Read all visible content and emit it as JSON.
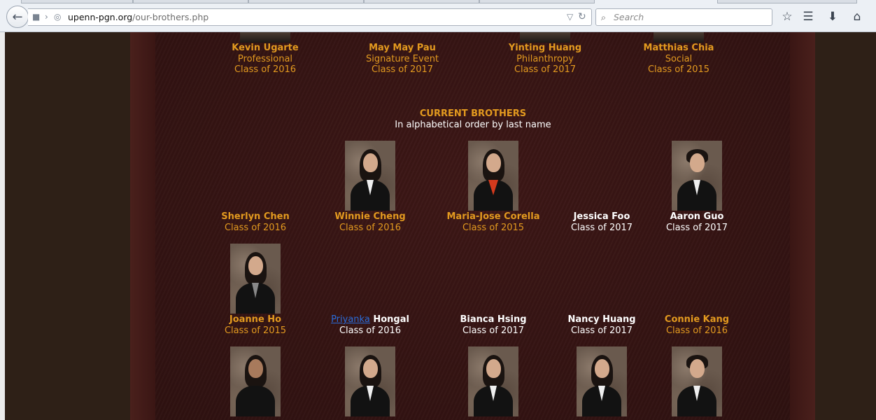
{
  "browser": {
    "url_host": "upenn-pgn.org",
    "url_path": "/our-brothers.php",
    "search_placeholder": "Search"
  },
  "officers": [
    {
      "name": "Kevin Ugarte",
      "role": "Professional",
      "class": "Class of 2016"
    },
    {
      "name": "May May Pau",
      "role": "Signature Event",
      "class": "Class of 2017"
    },
    {
      "name": "Yinting Huang",
      "role": "Philanthropy",
      "class": "Class of 2017"
    },
    {
      "name": "Matthias Chia",
      "role": "Social",
      "class": "Class of 2015"
    }
  ],
  "current": {
    "heading": "CURRENT BROTHERS",
    "subheading": "In alphabetical order by last name",
    "rows": [
      [
        {
          "name": "Sherlyn Chen",
          "class": "Class of 2016",
          "color": "#e39a1f"
        },
        {
          "name": "Winnie Cheng",
          "class": "Class of 2016",
          "color": "#e39a1f"
        },
        {
          "name": "Maria-Jose Corella",
          "class": "Class of 2015",
          "color": "#e39a1f"
        },
        {
          "name": "Jessica Foo",
          "class": "Class of 2017",
          "color": "#ffffff"
        },
        {
          "name": "Aaron Guo",
          "class": "Class of 2017",
          "color": "#ffffff"
        }
      ],
      [
        {
          "name": "Joanne Ho",
          "class": "Class of 2015",
          "color": "#e39a1f"
        },
        {
          "link": "Priyanka",
          "name": "Hongal",
          "class": "Class of 2016",
          "color": "#ffffff"
        },
        {
          "name": "Bianca Hsing",
          "class": "Class of 2017",
          "color": "#ffffff"
        },
        {
          "name": "Nancy Huang",
          "class": "Class of 2017",
          "color": "#ffffff"
        },
        {
          "name": "Connie Kang",
          "class": "Class of 2016",
          "color": "#e39a1f"
        }
      ]
    ]
  }
}
